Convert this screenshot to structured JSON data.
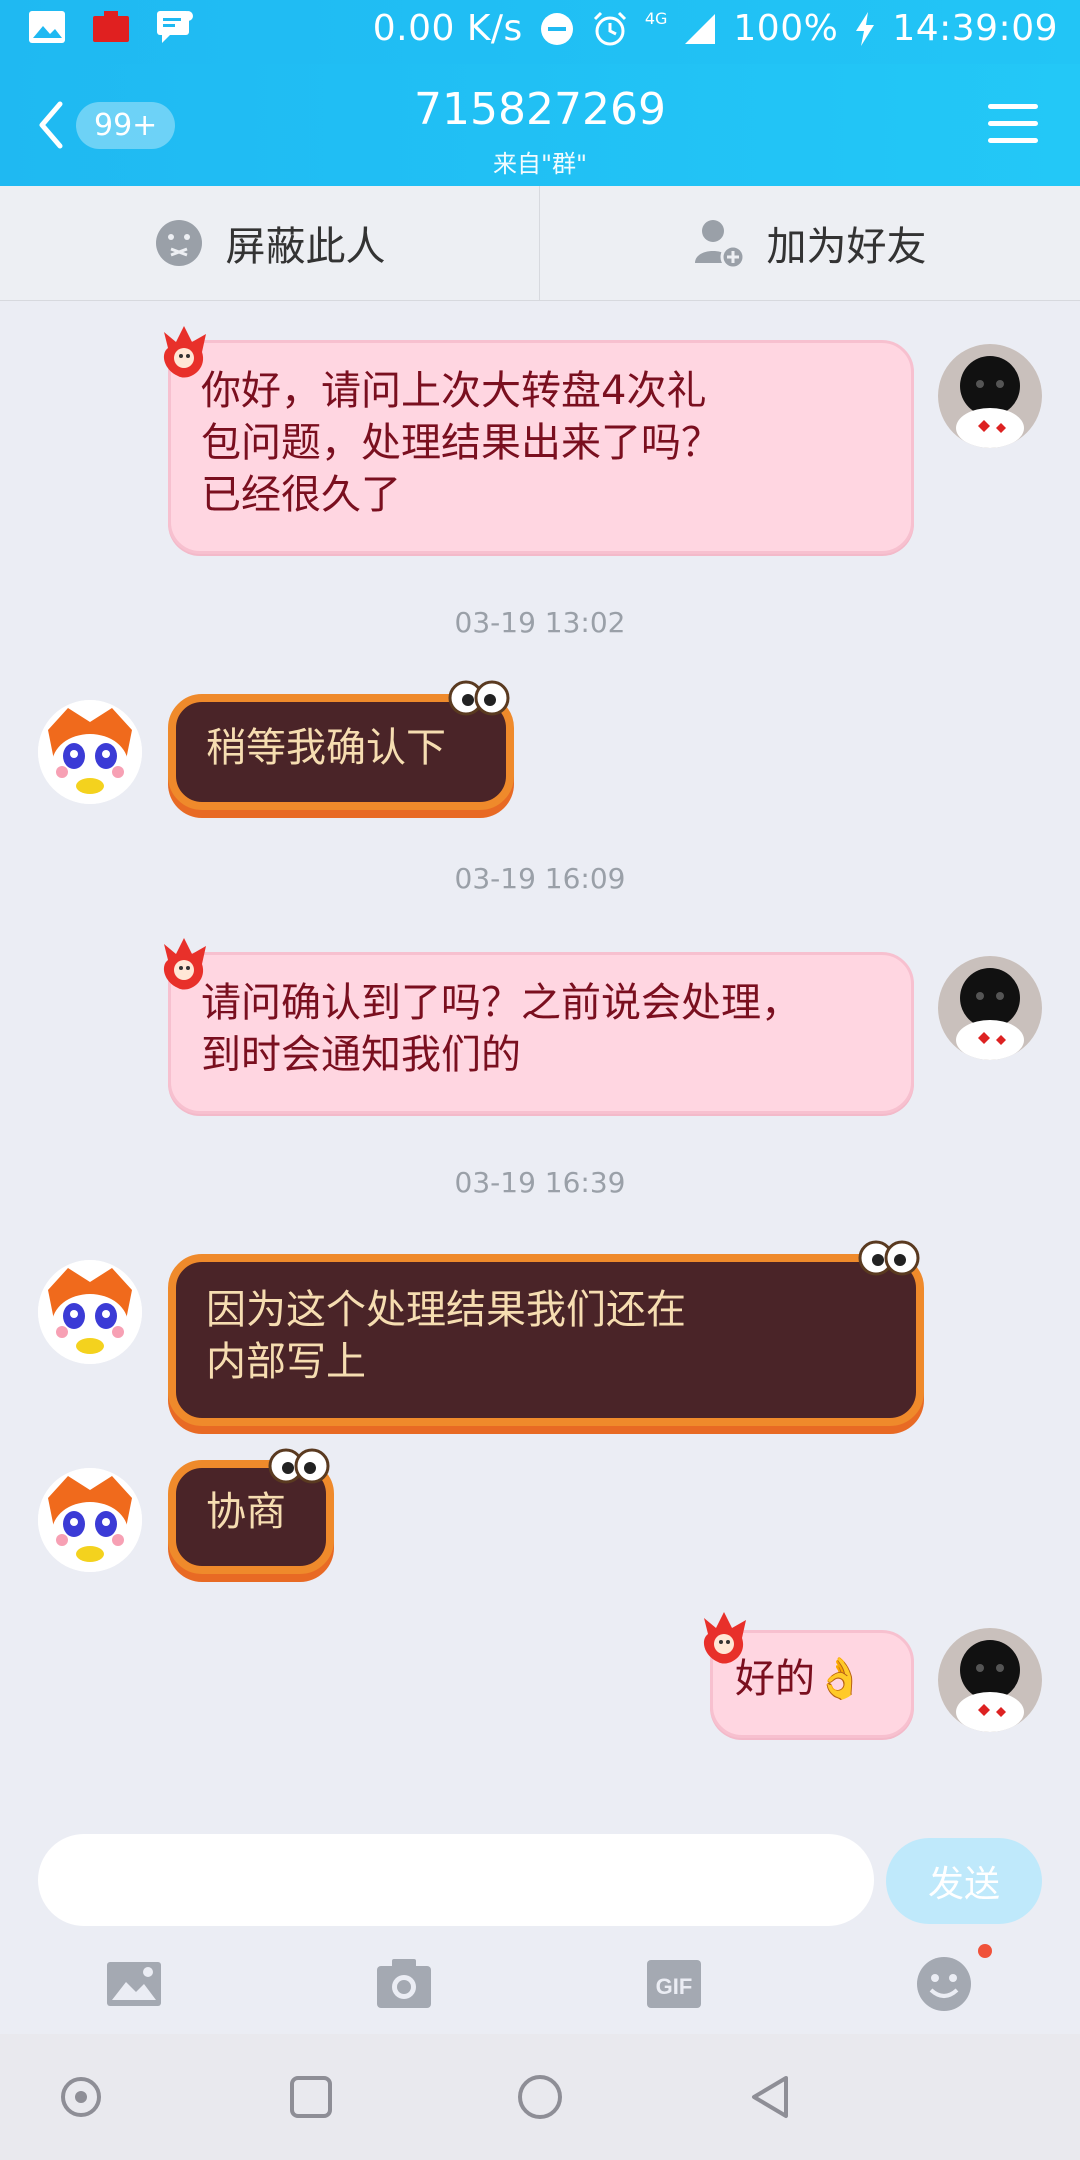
{
  "status_bar": {
    "net_speed": "0.00 K/s",
    "network": "4G",
    "battery": "100%",
    "time": "14:39:09"
  },
  "header": {
    "unread": "99+",
    "title": "715827269",
    "subtitle": "来自\"群\""
  },
  "actions": {
    "block_label": "屏蔽此人",
    "add_friend_label": "加为好友"
  },
  "messages": [
    {
      "side": "out",
      "text": "你好，请问上次大转盘4次礼\n包问题，处理结果出来了吗？\n已经很久了"
    },
    {
      "side": "in",
      "text": "稍等我确认下"
    },
    {
      "side": "out",
      "text": "请问确认到了吗？之前说会处理，\n到时会通知我们的"
    },
    {
      "side": "in",
      "text": "因为这个处理结果我们还在\n内部写上"
    },
    {
      "side": "in",
      "text": "协商"
    },
    {
      "side": "out",
      "text": "好的👌"
    }
  ],
  "timestamps": [
    "03-19 13:02",
    "03-19 16:09",
    "03-19 16:39"
  ],
  "composer": {
    "input_value": "",
    "send_label": "发送"
  },
  "colors": {
    "accent": "#1fb9f2",
    "outgoing_bubble": "#ffd6e1",
    "incoming_bubble": "#4a2428",
    "incoming_border": "#ef8a2b"
  }
}
